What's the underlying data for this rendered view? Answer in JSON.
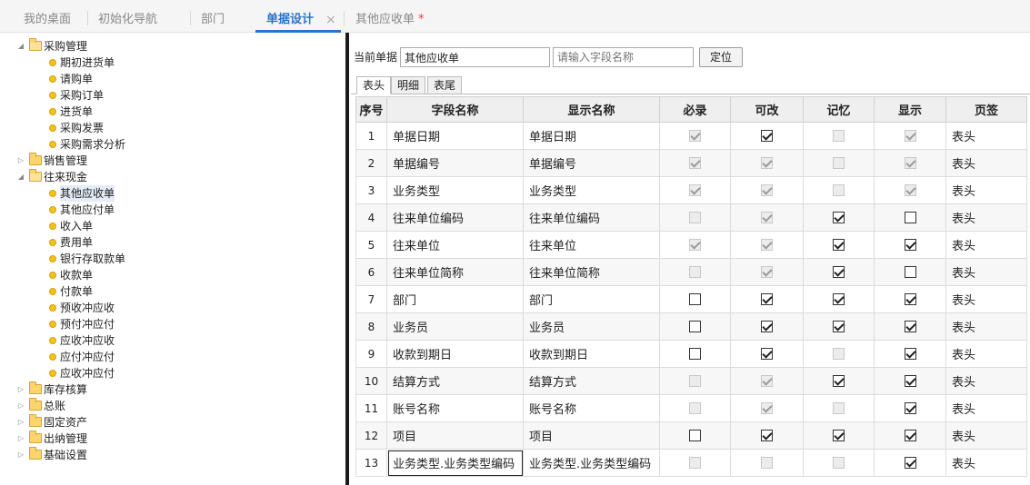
{
  "tabs": [
    {
      "label": "我的桌面",
      "active": false
    },
    {
      "label": "初始化导航",
      "active": false
    },
    {
      "label": "部门",
      "active": false
    },
    {
      "label": "单据设计",
      "active": true
    },
    {
      "label": "其他应收单",
      "active": false
    }
  ],
  "tab_close_glyph": "×",
  "tab_modified_mark": "*",
  "tree": [
    {
      "type": "folder",
      "label": "采购管理",
      "expanded": true,
      "level": 0
    },
    {
      "type": "leaf",
      "label": "期初进货单",
      "level": 1
    },
    {
      "type": "leaf",
      "label": "请购单",
      "level": 1
    },
    {
      "type": "leaf",
      "label": "采购订单",
      "level": 1
    },
    {
      "type": "leaf",
      "label": "进货单",
      "level": 1
    },
    {
      "type": "leaf",
      "label": "采购发票",
      "level": 1
    },
    {
      "type": "leaf",
      "label": "采购需求分析",
      "level": 1
    },
    {
      "type": "folder",
      "label": "销售管理",
      "expanded": false,
      "level": 0
    },
    {
      "type": "folder",
      "label": "往来现金",
      "expanded": true,
      "level": 0
    },
    {
      "type": "leaf",
      "label": "其他应收单",
      "level": 1,
      "selected": true
    },
    {
      "type": "leaf",
      "label": "其他应付单",
      "level": 1
    },
    {
      "type": "leaf",
      "label": "收入单",
      "level": 1
    },
    {
      "type": "leaf",
      "label": "费用单",
      "level": 1
    },
    {
      "type": "leaf",
      "label": "银行存取款单",
      "level": 1
    },
    {
      "type": "leaf",
      "label": "收款单",
      "level": 1
    },
    {
      "type": "leaf",
      "label": "付款单",
      "level": 1
    },
    {
      "type": "leaf",
      "label": "预收冲应收",
      "level": 1
    },
    {
      "type": "leaf",
      "label": "预付冲应付",
      "level": 1
    },
    {
      "type": "leaf",
      "label": "应收冲应收",
      "level": 1
    },
    {
      "type": "leaf",
      "label": "应付冲应付",
      "level": 1
    },
    {
      "type": "leaf",
      "label": "应收冲应付",
      "level": 1
    },
    {
      "type": "folder",
      "label": "库存核算",
      "expanded": false,
      "level": 0
    },
    {
      "type": "folder",
      "label": "总账",
      "expanded": false,
      "level": 0
    },
    {
      "type": "folder",
      "label": "固定资产",
      "expanded": false,
      "level": 0
    },
    {
      "type": "folder",
      "label": "出纳管理",
      "expanded": false,
      "level": 0
    },
    {
      "type": "folder",
      "label": "基础设置",
      "expanded": false,
      "level": 0
    }
  ],
  "search": {
    "current_label": "当前单据",
    "current_value": "其他应收单",
    "field_placeholder": "请输入字段名称",
    "locate_label": "定位"
  },
  "subtabs": [
    {
      "label": "表头",
      "active": true
    },
    {
      "label": "明细",
      "active": false
    },
    {
      "label": "表尾",
      "active": false
    }
  ],
  "table": {
    "headers": [
      "序号",
      "字段名称",
      "显示名称",
      "必录",
      "可改",
      "记忆",
      "显示",
      "页签"
    ],
    "rows": [
      {
        "no": "1",
        "field": "单据日期",
        "display": "单据日期",
        "required": [
          true,
          true
        ],
        "editable": [
          true,
          false
        ],
        "memory": [
          false,
          true
        ],
        "show": [
          true,
          true
        ],
        "page": "表头"
      },
      {
        "no": "2",
        "field": "单据编号",
        "display": "单据编号",
        "required": [
          true,
          true
        ],
        "editable": [
          true,
          true
        ],
        "memory": [
          false,
          true
        ],
        "show": [
          true,
          true
        ],
        "page": "表头"
      },
      {
        "no": "3",
        "field": "业务类型",
        "display": "业务类型",
        "required": [
          true,
          true
        ],
        "editable": [
          true,
          true
        ],
        "memory": [
          false,
          true
        ],
        "show": [
          true,
          true
        ],
        "page": "表头"
      },
      {
        "no": "4",
        "field": "往来单位编码",
        "display": "往来单位编码",
        "required": [
          false,
          true
        ],
        "editable": [
          true,
          true
        ],
        "memory": [
          true,
          false
        ],
        "show": [
          false,
          false
        ],
        "page": "表头"
      },
      {
        "no": "5",
        "field": "往来单位",
        "display": "往来单位",
        "required": [
          true,
          true
        ],
        "editable": [
          true,
          true
        ],
        "memory": [
          true,
          false
        ],
        "show": [
          true,
          false
        ],
        "page": "表头"
      },
      {
        "no": "6",
        "field": "往来单位简称",
        "display": "往来单位简称",
        "required": [
          false,
          true
        ],
        "editable": [
          true,
          true
        ],
        "memory": [
          true,
          false
        ],
        "show": [
          false,
          false
        ],
        "page": "表头"
      },
      {
        "no": "7",
        "field": "部门",
        "display": "部门",
        "required": [
          false,
          false
        ],
        "editable": [
          true,
          false
        ],
        "memory": [
          true,
          false
        ],
        "show": [
          true,
          false
        ],
        "page": "表头"
      },
      {
        "no": "8",
        "field": "业务员",
        "display": "业务员",
        "required": [
          false,
          false
        ],
        "editable": [
          true,
          false
        ],
        "memory": [
          true,
          false
        ],
        "show": [
          true,
          false
        ],
        "page": "表头"
      },
      {
        "no": "9",
        "field": "收款到期日",
        "display": "收款到期日",
        "required": [
          false,
          false
        ],
        "editable": [
          true,
          false
        ],
        "memory": [
          false,
          true
        ],
        "show": [
          true,
          false
        ],
        "page": "表头"
      },
      {
        "no": "10",
        "field": "结算方式",
        "display": "结算方式",
        "required": [
          false,
          true
        ],
        "editable": [
          true,
          true
        ],
        "memory": [
          true,
          false
        ],
        "show": [
          true,
          false
        ],
        "page": "表头"
      },
      {
        "no": "11",
        "field": "账号名称",
        "display": "账号名称",
        "required": [
          false,
          true
        ],
        "editable": [
          true,
          true
        ],
        "memory": [
          false,
          true
        ],
        "show": [
          true,
          false
        ],
        "page": "表头"
      },
      {
        "no": "12",
        "field": "项目",
        "display": "项目",
        "required": [
          false,
          false
        ],
        "editable": [
          true,
          false
        ],
        "memory": [
          true,
          false
        ],
        "show": [
          true,
          false
        ],
        "page": "表头"
      },
      {
        "no": "13",
        "field": "业务类型.业务类型编码",
        "display": "业务类型.业务类型编码",
        "required": [
          false,
          true
        ],
        "editable": [
          false,
          true
        ],
        "memory": [
          false,
          true
        ],
        "show": [
          true,
          false
        ],
        "page": "表头"
      }
    ]
  }
}
